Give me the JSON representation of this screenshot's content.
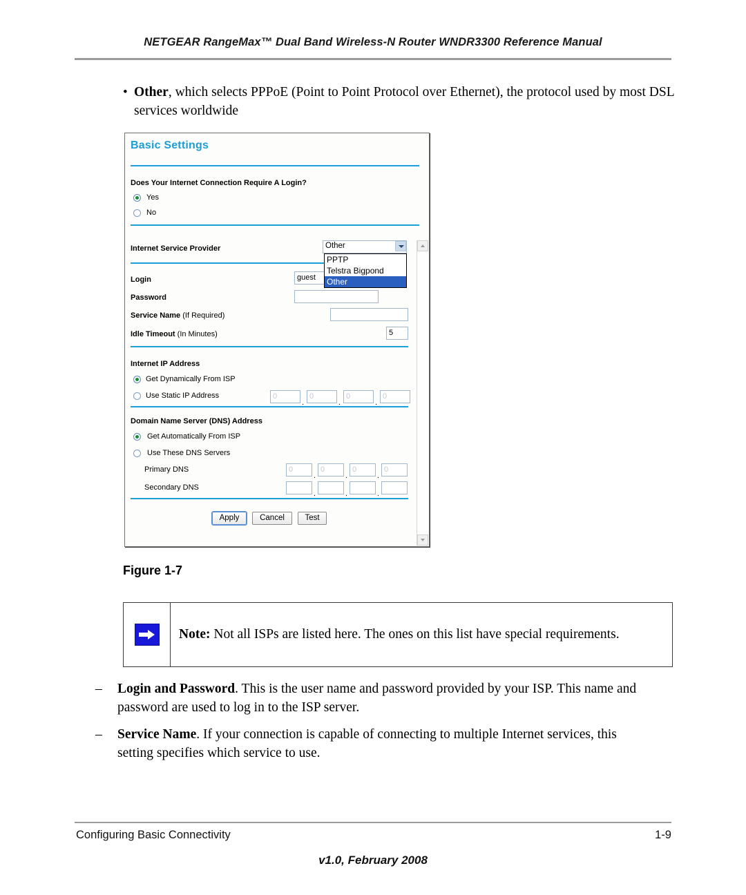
{
  "header": {
    "title": "NETGEAR RangeMax™ Dual Band Wireless-N Router WNDR3300 Reference Manual"
  },
  "intro_bullet": {
    "marker": "•",
    "bold_lead": "Other",
    "rest": ", which selects PPPoE (Point to Point Protocol over Ethernet), the protocol used by most DSL services worldwide"
  },
  "figure": {
    "caption": "Figure 1-7",
    "panel_title": "Basic Settings",
    "login_question": "Does Your Internet Connection Require A Login?",
    "login_yes": "Yes",
    "login_no": "No",
    "isp_label": "Internet Service Provider",
    "isp_selected": "Other",
    "isp_options": [
      "PPTP",
      "Telstra Bigpond",
      "Other"
    ],
    "login_label": "Login",
    "login_value": "guest",
    "password_label": "Password",
    "password_value": "",
    "service_name_label": "Service Name",
    "service_name_suffix": "(If Required)",
    "service_name_value": "",
    "idle_timeout_label": "Idle Timeout",
    "idle_timeout_suffix": "(In Minutes)",
    "idle_timeout_value": "5",
    "internet_ip_heading": "Internet IP Address",
    "ip_dynamic": "Get Dynamically From ISP",
    "ip_static": "Use Static IP Address",
    "static_ip_octets": [
      "0",
      "0",
      "0",
      "0"
    ],
    "dns_heading": "Domain Name Server (DNS) Address",
    "dns_auto": "Get Automatically From ISP",
    "dns_manual": "Use These DNS Servers",
    "primary_dns_label": "Primary DNS",
    "primary_dns_octets": [
      "0",
      "0",
      "0",
      "0"
    ],
    "secondary_dns_label": "Secondary DNS",
    "secondary_dns_octets": [
      "",
      "",
      "",
      ""
    ],
    "btn_apply": "Apply",
    "btn_cancel": "Cancel",
    "btn_test": "Test",
    "accent_color": "#1a9ed4",
    "selected_option_color": "#2a5fc0",
    "radio_dot_color": "#1a8a3c"
  },
  "note": {
    "label": "Note:",
    "text": "Not all ISPs are listed here. The ones on this list have special requirements.",
    "icon_color": "#1818d8"
  },
  "dash_bullets": [
    {
      "marker": "–",
      "bold_lead": "Login and Password",
      "rest": ". This is the user name and password provided by your ISP. This name and password are used to log in to the ISP server."
    },
    {
      "marker": "–",
      "bold_lead": "Service Name",
      "rest": ". If your connection is capable of connecting to multiple Internet services, this setting specifies which service to use."
    }
  ],
  "footer": {
    "left": "Configuring Basic Connectivity",
    "page": "1-9",
    "version": "v1.0, February 2008"
  }
}
